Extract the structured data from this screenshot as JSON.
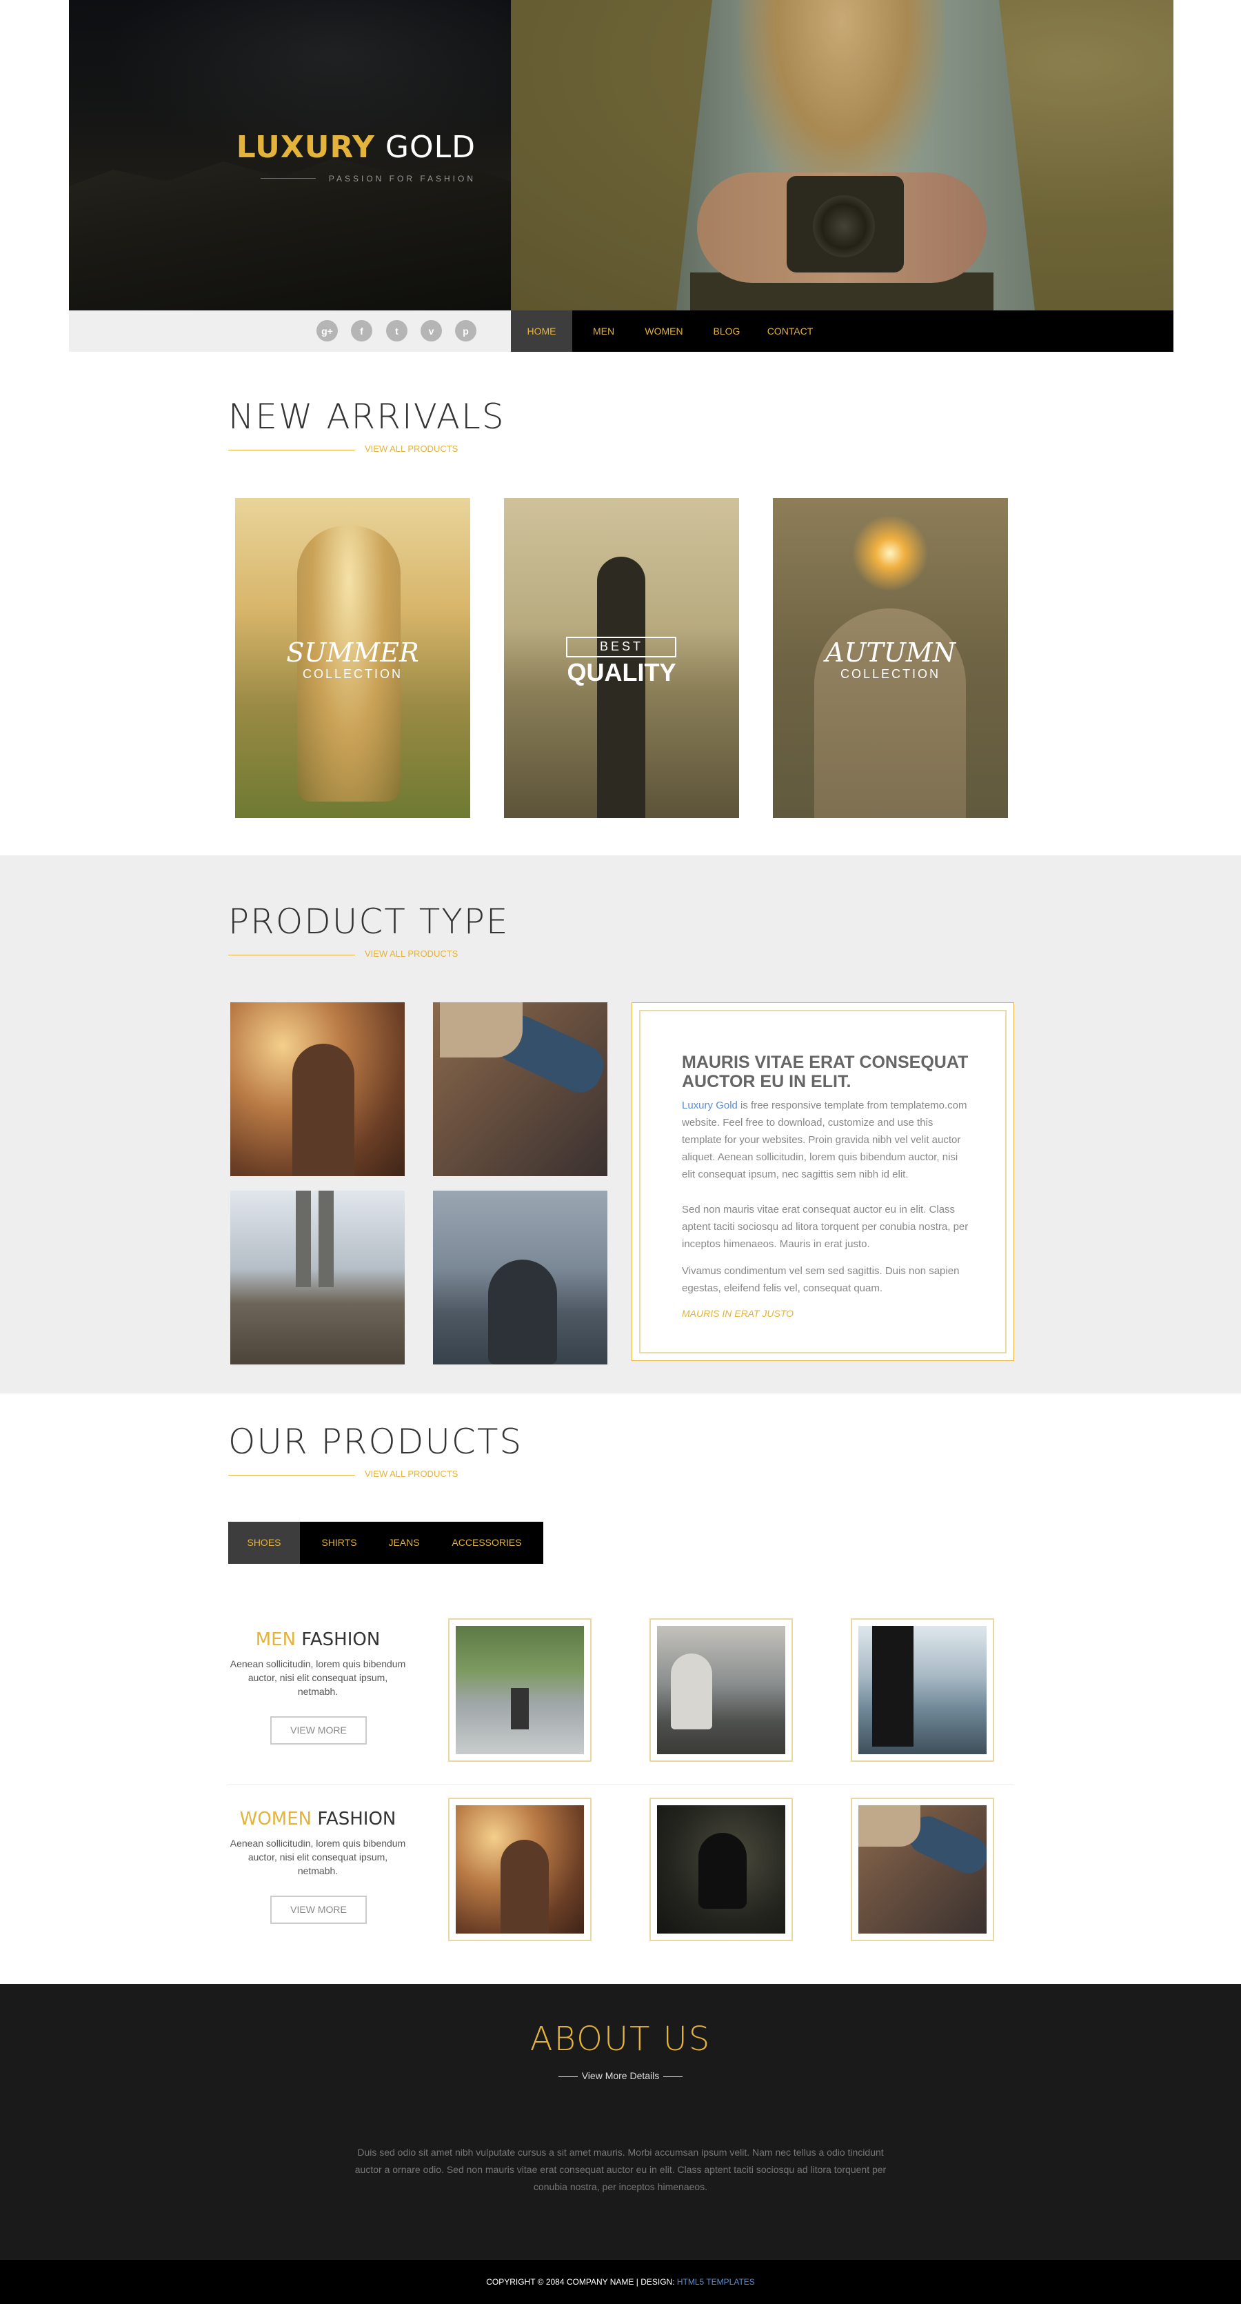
{
  "header": {
    "logo_part1": "LUXURY",
    "logo_part2": "GOLD",
    "tagline": "PASSION FOR FASHION",
    "social_icons": [
      "google-plus-icon",
      "facebook-icon",
      "twitter-icon",
      "vimeo-icon",
      "pinterest-icon"
    ],
    "nav": [
      "HOME",
      "MEN",
      "WOMEN",
      "BLOG",
      "CONTACT"
    ]
  },
  "new_arrivals": {
    "title": "NEW ARRIVALS",
    "link": "VIEW ALL PRODUCTS",
    "cards": [
      {
        "line1": "SUMMER",
        "line2": "COLLECTION"
      },
      {
        "line1": "BEST",
        "line2": "QUALITY"
      },
      {
        "line1": "AUTUMN",
        "line2": "COLLECTION"
      }
    ]
  },
  "product_type": {
    "title": "PRODUCT TYPE",
    "link": "VIEW ALL PRODUCTS",
    "heading": "MAURIS VITAE ERAT CONSEQUAT AUCTOR EU IN ELIT.",
    "brand_link": "Luxury Gold",
    "p1_rest": " is free responsive template from templatemo.com website. Feel free to download, customize and use this template for your websites. Proin gravida nibh vel velit auctor aliquet. Aenean sollicitudin, lorem quis bibendum auctor, nisi elit consequat ipsum, nec sagittis sem nibh id elit.",
    "p2": "Sed non mauris vitae erat consequat auctor eu in elit. Class aptent taciti sociosqu ad litora torquent per conubia nostra, per inceptos himenaeos. Mauris in erat justo.",
    "p3": "Vivamus condimentum vel sem sed sagittis. Duis non sapien egestas, eleifend felis vel, consequat quam.",
    "more_link": "MAURIS IN ERAT JUSTO"
  },
  "our_products": {
    "title": "OUR PRODUCTS",
    "link": "VIEW ALL PRODUCTS",
    "tabs": [
      "SHOES",
      "SHIRTS",
      "JEANS",
      "ACCESSORIES"
    ],
    "rows": [
      {
        "accent": "MEN",
        "word": "FASHION",
        "desc": "Aenean sollicitudin, lorem quis bibendum auctor, nisi elit consequat ipsum, netmabh.",
        "button": "VIEW MORE"
      },
      {
        "accent": "WOMEN",
        "word": "FASHION",
        "desc": "Aenean sollicitudin, lorem quis bibendum auctor, nisi elit consequat ipsum, netmabh.",
        "button": "VIEW MORE"
      }
    ]
  },
  "about": {
    "title": "ABOUT US",
    "sub": "View More Details",
    "text": "Duis sed odio sit amet nibh vulputate cursus a sit amet mauris. Morbi accumsan ipsum velit. Nam nec tellus a odio tincidunt auctor a ornare odio. Sed non mauris vitae erat consequat auctor eu in elit. Class aptent taciti sociosqu ad litora torquent per conubia nostra, per inceptos himenaeos."
  },
  "footer": {
    "copyright": "COPYRIGHT © 2084 COMPANY NAME | DESIGN: ",
    "design_link": "HTML5 TEMPLATES"
  },
  "colors": {
    "gold": "#e4b33b",
    "dark": "#1a1a1a",
    "nav_active": "#3d3d3d"
  }
}
